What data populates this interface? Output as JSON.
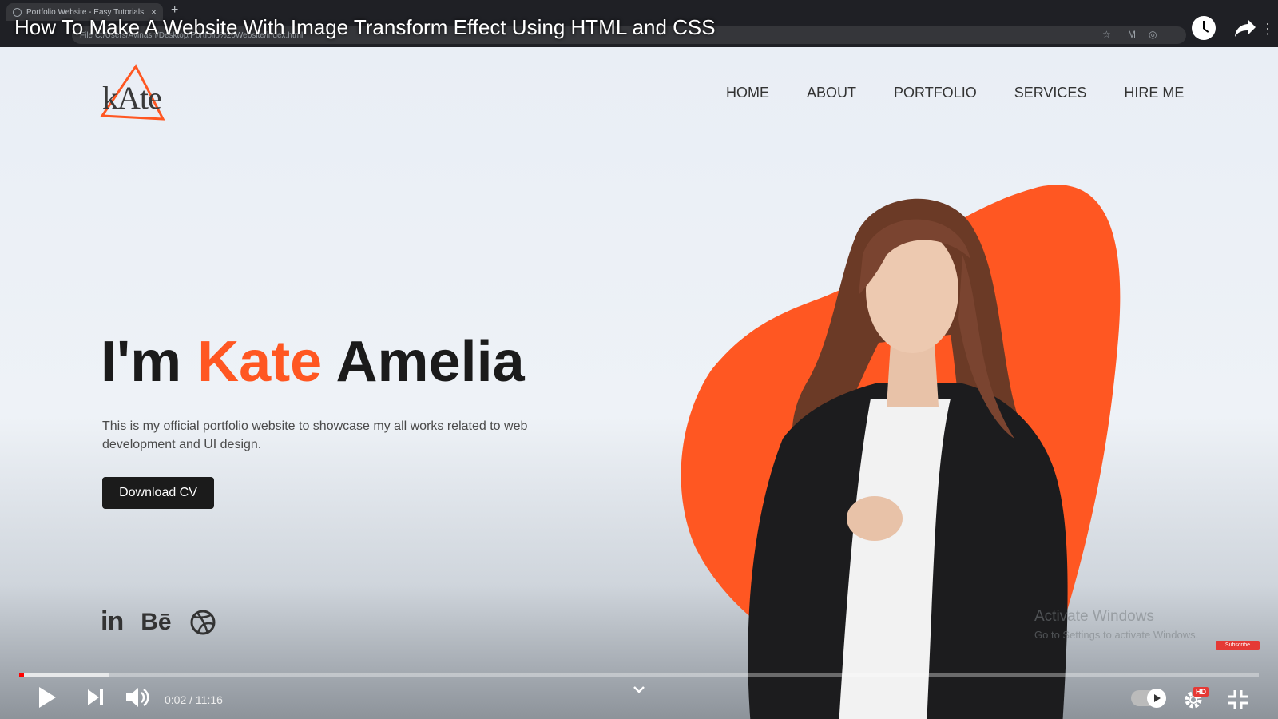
{
  "browser": {
    "tab_title": "Portfolio Website - Easy Tutorials",
    "url": "File C:/Users/Avinash/Desktop/Portfolio%20Website/index.html"
  },
  "video": {
    "title": "How To Make A Website With Image Transform Effect Using HTML and CSS",
    "current_time": "0:02",
    "duration": "11:16",
    "time_display": "0:02 / 11:16",
    "progress_fraction": 0.003,
    "buffered_fraction": 0.072,
    "quality_badge": "HD",
    "subscribe_badge": "Subscribe"
  },
  "site": {
    "logo_text": "kAte",
    "nav": [
      "HOME",
      "ABOUT",
      "PORTFOLIO",
      "SERVICES",
      "HIRE ME"
    ],
    "hero": {
      "prefix": "I'm ",
      "accent": "Kate",
      "suffix": " Amelia",
      "description": "This is my official portfolio website to showcase my all works related to web development and UI design.",
      "cta_label": "Download CV"
    },
    "social_labels": [
      "in",
      "Bē"
    ]
  },
  "watermark": {
    "line1": "Activate Windows",
    "line2": "Go to Settings to activate Windows."
  },
  "colors": {
    "accent": "#ff5722",
    "dark": "#1b1b1b",
    "progress_played": "#ff0000"
  }
}
